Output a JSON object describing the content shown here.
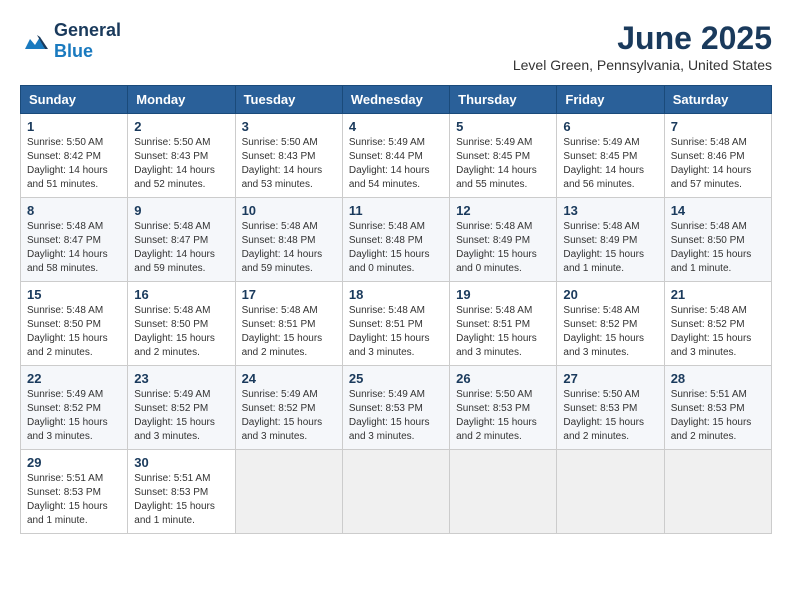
{
  "logo": {
    "text_general": "General",
    "text_blue": "Blue"
  },
  "header": {
    "month_year": "June 2025",
    "location": "Level Green, Pennsylvania, United States"
  },
  "days_of_week": [
    "Sunday",
    "Monday",
    "Tuesday",
    "Wednesday",
    "Thursday",
    "Friday",
    "Saturday"
  ],
  "weeks": [
    [
      {
        "day": "1",
        "sunrise": "5:50 AM",
        "sunset": "8:42 PM",
        "daylight": "14 hours and 51 minutes."
      },
      {
        "day": "2",
        "sunrise": "5:50 AM",
        "sunset": "8:43 PM",
        "daylight": "14 hours and 52 minutes."
      },
      {
        "day": "3",
        "sunrise": "5:50 AM",
        "sunset": "8:43 PM",
        "daylight": "14 hours and 53 minutes."
      },
      {
        "day": "4",
        "sunrise": "5:49 AM",
        "sunset": "8:44 PM",
        "daylight": "14 hours and 54 minutes."
      },
      {
        "day": "5",
        "sunrise": "5:49 AM",
        "sunset": "8:45 PM",
        "daylight": "14 hours and 55 minutes."
      },
      {
        "day": "6",
        "sunrise": "5:49 AM",
        "sunset": "8:45 PM",
        "daylight": "14 hours and 56 minutes."
      },
      {
        "day": "7",
        "sunrise": "5:48 AM",
        "sunset": "8:46 PM",
        "daylight": "14 hours and 57 minutes."
      }
    ],
    [
      {
        "day": "8",
        "sunrise": "5:48 AM",
        "sunset": "8:47 PM",
        "daylight": "14 hours and 58 minutes."
      },
      {
        "day": "9",
        "sunrise": "5:48 AM",
        "sunset": "8:47 PM",
        "daylight": "14 hours and 59 minutes."
      },
      {
        "day": "10",
        "sunrise": "5:48 AM",
        "sunset": "8:48 PM",
        "daylight": "14 hours and 59 minutes."
      },
      {
        "day": "11",
        "sunrise": "5:48 AM",
        "sunset": "8:48 PM",
        "daylight": "15 hours and 0 minutes."
      },
      {
        "day": "12",
        "sunrise": "5:48 AM",
        "sunset": "8:49 PM",
        "daylight": "15 hours and 0 minutes."
      },
      {
        "day": "13",
        "sunrise": "5:48 AM",
        "sunset": "8:49 PM",
        "daylight": "15 hours and 1 minute."
      },
      {
        "day": "14",
        "sunrise": "5:48 AM",
        "sunset": "8:50 PM",
        "daylight": "15 hours and 1 minute."
      }
    ],
    [
      {
        "day": "15",
        "sunrise": "5:48 AM",
        "sunset": "8:50 PM",
        "daylight": "15 hours and 2 minutes."
      },
      {
        "day": "16",
        "sunrise": "5:48 AM",
        "sunset": "8:50 PM",
        "daylight": "15 hours and 2 minutes."
      },
      {
        "day": "17",
        "sunrise": "5:48 AM",
        "sunset": "8:51 PM",
        "daylight": "15 hours and 2 minutes."
      },
      {
        "day": "18",
        "sunrise": "5:48 AM",
        "sunset": "8:51 PM",
        "daylight": "15 hours and 3 minutes."
      },
      {
        "day": "19",
        "sunrise": "5:48 AM",
        "sunset": "8:51 PM",
        "daylight": "15 hours and 3 minutes."
      },
      {
        "day": "20",
        "sunrise": "5:48 AM",
        "sunset": "8:52 PM",
        "daylight": "15 hours and 3 minutes."
      },
      {
        "day": "21",
        "sunrise": "5:48 AM",
        "sunset": "8:52 PM",
        "daylight": "15 hours and 3 minutes."
      }
    ],
    [
      {
        "day": "22",
        "sunrise": "5:49 AM",
        "sunset": "8:52 PM",
        "daylight": "15 hours and 3 minutes."
      },
      {
        "day": "23",
        "sunrise": "5:49 AM",
        "sunset": "8:52 PM",
        "daylight": "15 hours and 3 minutes."
      },
      {
        "day": "24",
        "sunrise": "5:49 AM",
        "sunset": "8:52 PM",
        "daylight": "15 hours and 3 minutes."
      },
      {
        "day": "25",
        "sunrise": "5:49 AM",
        "sunset": "8:53 PM",
        "daylight": "15 hours and 3 minutes."
      },
      {
        "day": "26",
        "sunrise": "5:50 AM",
        "sunset": "8:53 PM",
        "daylight": "15 hours and 2 minutes."
      },
      {
        "day": "27",
        "sunrise": "5:50 AM",
        "sunset": "8:53 PM",
        "daylight": "15 hours and 2 minutes."
      },
      {
        "day": "28",
        "sunrise": "5:51 AM",
        "sunset": "8:53 PM",
        "daylight": "15 hours and 2 minutes."
      }
    ],
    [
      {
        "day": "29",
        "sunrise": "5:51 AM",
        "sunset": "8:53 PM",
        "daylight": "15 hours and 1 minute."
      },
      {
        "day": "30",
        "sunrise": "5:51 AM",
        "sunset": "8:53 PM",
        "daylight": "15 hours and 1 minute."
      },
      null,
      null,
      null,
      null,
      null
    ]
  ]
}
